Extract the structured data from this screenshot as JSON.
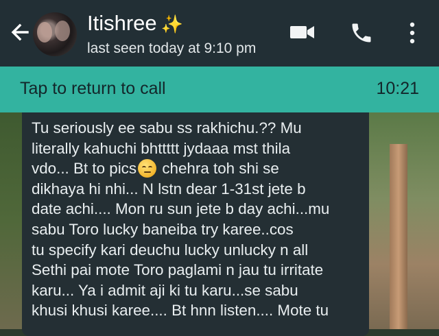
{
  "header": {
    "contact_name": "Itishree",
    "contact_emoji": "✨",
    "last_seen": "last seen today at 9:10 pm",
    "icons": {
      "back": "back-arrow-icon",
      "video": "video-call-icon",
      "call": "phone-icon",
      "menu": "more-vert-icon"
    }
  },
  "call_banner": {
    "label": "Tap to return to call",
    "time": "10:21",
    "color": "#33b3a0"
  },
  "message": {
    "lines": [
      "Tu seriously ee sabu ss rakhichu.?? Mu",
      "literally kahuchi bhttttt jydaaa mst thila",
      "vdo... Bt to pics",
      "chehra toh shi se",
      "dikhaya hi nhi... N lstn dear 1-31st jete b",
      "date achi.... Mon ru sun jete b day achi...mu",
      "sabu Toro lucky baneiba try karee..cos",
      "tu specify kari deuchu lucky unlucky n all",
      "Sethi pai mote Toro paglami n jau tu irritate",
      "karu... Ya i admit aji ki tu karu...se sabu",
      "khusi khusi karee.... Bt hnn listen.... Mote tu"
    ],
    "inline_emoji": "unamused-face-emoji"
  },
  "colors": {
    "appbar": "#222f35",
    "bubble": "#242f34",
    "text": "#e9eef0"
  }
}
